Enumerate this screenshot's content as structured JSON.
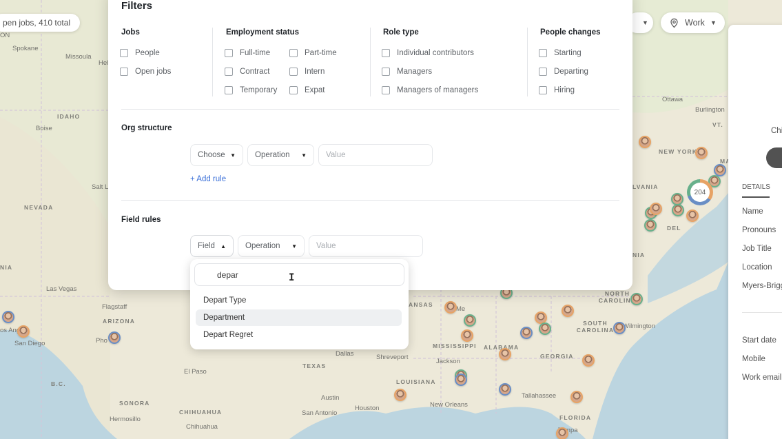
{
  "top_chip": {
    "text": "pen jobs, 410 total"
  },
  "top_right": {
    "work_label": "Work"
  },
  "map": {
    "labels": [
      "Spokane",
      "Missoula",
      "Hel",
      "IDAHO",
      "Boise",
      "NEVADA",
      "Salt L",
      "NIA",
      "Las Vegas",
      "Flagstaff",
      "ARIZONA",
      "os Ang",
      "San Diego",
      "Pho",
      "B.C.",
      "El Paso",
      "SONORA",
      "Hermosillo",
      "CHIHUAHUA",
      "Chihuahua",
      "TEXAS",
      "Dallas",
      "Shreveport",
      "Austin",
      "San Antonio",
      "Houston",
      "LOUISIANA",
      "New Orleans",
      "Jackson",
      "MISSISSIPPI",
      "ALABAMA",
      "GEORGIA",
      "Tallahassee",
      "FLORIDA",
      "Tampa",
      "SOUTH CAROLINA",
      "Wilmington",
      "NORTH CAROLINA",
      "NIA",
      "DEL",
      "LVANIA",
      "NEW YORK",
      "MA",
      "Ottawa",
      "Burlington",
      "VT.",
      "ANSAS",
      "Me",
      "ON"
    ],
    "cluster_count": "204"
  },
  "side_panel": {
    "partial_text": "Chi",
    "tab": "DETAILS",
    "fields": [
      "Name",
      "Pronouns",
      "Job Title",
      "Location",
      "Myers-Brigg",
      "Start date",
      "Mobile",
      "Work email"
    ]
  },
  "filters": {
    "title": "Filters",
    "jobs": {
      "title": "Jobs",
      "options": [
        "People",
        "Open jobs"
      ]
    },
    "employment": {
      "title": "Employment status",
      "col1": [
        "Full-time",
        "Contract",
        "Temporary"
      ],
      "col2": [
        "Part-time",
        "Intern",
        "Expat"
      ]
    },
    "role": {
      "title": "Role type",
      "options": [
        "Individual contributors",
        "Managers",
        "Managers of managers"
      ]
    },
    "people_changes": {
      "title": "People changes",
      "options": [
        "Starting",
        "Departing",
        "Hiring"
      ]
    },
    "org": {
      "title": "Org structure",
      "choose": "Choose",
      "operation": "Operation",
      "value_placeholder": "Value",
      "add_rule": "+ Add rule"
    },
    "field_rules": {
      "title": "Field rules",
      "field": "Field",
      "operation": "Operation",
      "value_placeholder": "Value"
    }
  },
  "dropdown": {
    "search_value": "depar",
    "items": [
      "Depart Type",
      "Department",
      "Depart Regret"
    ],
    "highlighted": "Department"
  }
}
